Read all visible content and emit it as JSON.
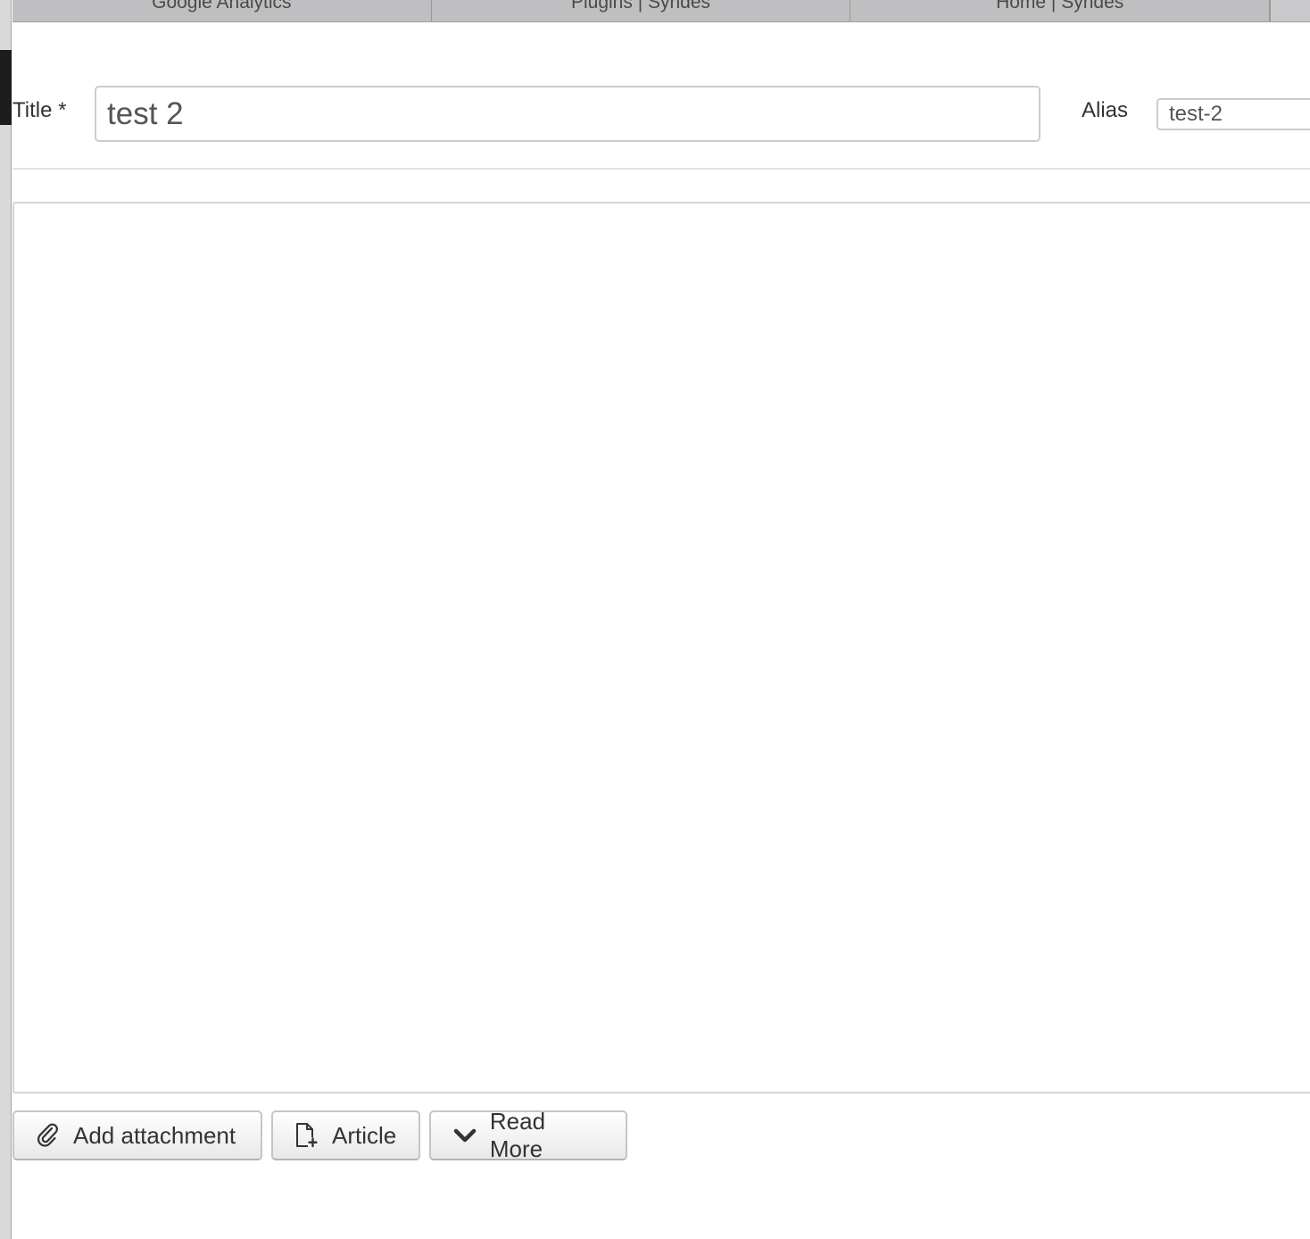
{
  "browser": {
    "tabs": [
      {
        "label": "Google Analytics"
      },
      {
        "label": "Plugins | Syndes"
      },
      {
        "label": "Home | Syndes"
      }
    ]
  },
  "form": {
    "title_label": "Title *",
    "title_value": "test 2",
    "alias_label": "Alias",
    "alias_value": "test-2"
  },
  "editor": {
    "content": ""
  },
  "buttons": {
    "add_attachment": {
      "label": "Add attachment",
      "icon": "paperclip-icon"
    },
    "article": {
      "label": "Article",
      "icon": "file-add-icon"
    },
    "read_more": {
      "label": "Read More",
      "icon": "chevron-down-icon"
    }
  }
}
